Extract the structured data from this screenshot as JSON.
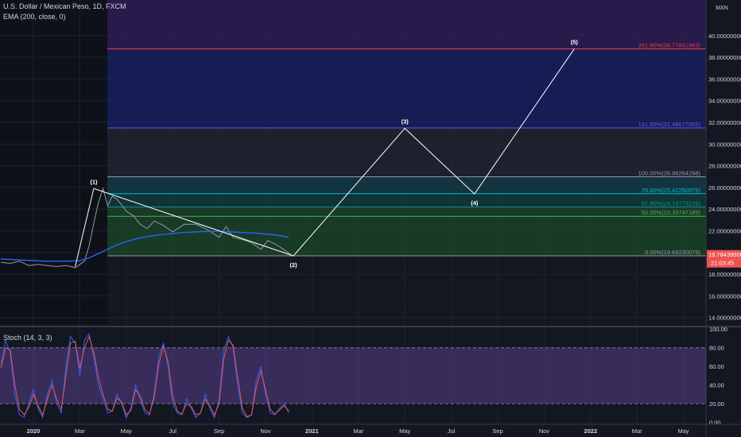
{
  "header": {
    "symbol_title": "U.S. Dollar / Mexican Peso, 1D, FXCM",
    "ema_label": "EMA (200, close, 0)",
    "stoch_label": "Stoch (14, 3, 3)",
    "currency": "MXN"
  },
  "colors": {
    "background": "#131722",
    "axis_text": "#d1d4dc",
    "price_line": "#9598a1",
    "ema": "#2962ff",
    "wave": "#ffffff",
    "stoch_k": "#2962ff",
    "stoch_d": "#ef5350",
    "price_tag": "#ef5350"
  },
  "chart_data": [
    {
      "type": "line",
      "title": "U.S. Dollar / Mexican Peso, 1D, FXCM",
      "xlabel": "",
      "ylabel": "",
      "ylim": [
        13,
        41
      ],
      "yticks": [
        14,
        16,
        18,
        20,
        22,
        24,
        26,
        28,
        30,
        32,
        34,
        36,
        38,
        40
      ],
      "ytick_labels": [
        "14.00000000",
        "16.00000000",
        "18.00000000",
        "20.00000000",
        "22.00000000",
        "24.00000000",
        "26.00000000",
        "28.00000000",
        "30.00000000",
        "32.00000000",
        "34.00000000",
        "36.00000000",
        "38.00000000",
        "40.00000000"
      ],
      "x_axis_labels": [
        "2020",
        "Mar",
        "May",
        "Jul",
        "Sep",
        "Nov",
        "2021",
        "Mar",
        "May",
        "Jul",
        "Sep",
        "Nov",
        "2022",
        "Mar",
        "May"
      ],
      "x_axis_months": [
        0,
        2,
        4,
        6,
        8,
        10,
        12,
        14,
        16,
        18,
        20,
        22,
        24,
        26,
        28
      ],
      "current_price": {
        "value": 19.78439,
        "label": "19.78439000",
        "countdown": "21:03:45"
      },
      "price_series": {
        "name": "USDMXN",
        "x": [
          -1.4,
          -1,
          -0.6,
          -0.2,
          0.2,
          0.6,
          1,
          1.4,
          1.8,
          2.0,
          2.2,
          2.4,
          2.6,
          2.8,
          3.0,
          3.2,
          3.4,
          3.6,
          3.8,
          4.0,
          4.3,
          4.6,
          4.9,
          5.2,
          5.6,
          6,
          6.5,
          7,
          7.5,
          8,
          8.3,
          8.6,
          9,
          9.4,
          9.8,
          10.1,
          10.4,
          10.7,
          11.1
        ],
        "y": [
          19.1,
          19.0,
          19.2,
          18.8,
          18.9,
          18.8,
          18.7,
          18.8,
          18.6,
          18.9,
          19.2,
          20.6,
          22.7,
          24.6,
          25.9,
          24.3,
          25.2,
          24.9,
          24.4,
          23.8,
          23.4,
          22.6,
          22.2,
          22.9,
          22.5,
          21.9,
          22.6,
          22.6,
          22.1,
          21.4,
          22.4,
          21.4,
          21.2,
          20.9,
          20.3,
          21.1,
          20.8,
          20.4,
          19.78
        ]
      },
      "ema_series": {
        "name": "EMA (200, close, 0)",
        "x": [
          -1.4,
          -0.5,
          0.5,
          1.5,
          2.0,
          2.4,
          2.8,
          3.2,
          3.6,
          4.0,
          4.5,
          5.0,
          5.5,
          6.0,
          6.5,
          7.0,
          7.5,
          8.0,
          8.5,
          9.0,
          9.5,
          10.0,
          10.5,
          11.0
        ],
        "y": [
          19.4,
          19.3,
          19.2,
          19.2,
          19.25,
          19.5,
          19.9,
          20.3,
          20.7,
          21.0,
          21.3,
          21.5,
          21.65,
          21.75,
          21.85,
          21.9,
          21.95,
          21.95,
          21.9,
          21.85,
          21.8,
          21.7,
          21.6,
          21.4
        ]
      },
      "elliott_waves": [
        {
          "label": "(1)",
          "x": 2.6,
          "y": 25.9
        },
        {
          "label": "(2)",
          "x": 11.2,
          "y": 19.69
        },
        {
          "label": "(3)",
          "x": 16.0,
          "y": 31.45
        },
        {
          "label": "(4)",
          "x": 19.0,
          "y": 25.4
        },
        {
          "label": "(5)",
          "x": 23.3,
          "y": 38.78
        }
      ],
      "wave_start": {
        "x": 1.8,
        "y": 18.7
      },
      "fib_levels": [
        {
          "ratio": "0.00%",
          "value": 19.69230079,
          "label": "0.00%(19.69230079)",
          "color": "#9598a1"
        },
        {
          "ratio": "50.00%",
          "value": 23.33747189,
          "label": "50.00%(23.33747189)",
          "color": "#4caf50"
        },
        {
          "ratio": "61.80%",
          "value": 24.19773226,
          "label": "61.80%(24.19773226)",
          "color": "#089981"
        },
        {
          "ratio": "78.60%",
          "value": 25.42250975,
          "label": "78.60%(25.42250975)",
          "color": "#00bcd4"
        },
        {
          "ratio": "100.00%",
          "value": 26.98264298,
          "label": "100.00%(26.98264298)",
          "color": "#9598a1"
        },
        {
          "ratio": "161.80%",
          "value": 31.48677805,
          "label": "161.80%(31.48677805)",
          "color": "#5b5ce2"
        },
        {
          "ratio": "261.80%",
          "value": 38.77841863,
          "label": "261.80%(38.77841863)",
          "color": "#f23645"
        }
      ]
    },
    {
      "type": "line",
      "title": "Stoch (14, 3, 3)",
      "ylim": [
        -3,
        100
      ],
      "yticks": [
        0,
        20,
        40,
        60,
        80,
        100
      ],
      "ytick_labels": [
        "0.00",
        "20.00",
        "40.00",
        "60.00",
        "80.00",
        "100.00"
      ],
      "bands": [
        20,
        80
      ],
      "series": [
        {
          "name": "%K",
          "x": [
            -1.4,
            -1.2,
            -1,
            -0.8,
            -0.6,
            -0.4,
            -0.2,
            0,
            0.2,
            0.4,
            0.6,
            0.8,
            1,
            1.2,
            1.4,
            1.6,
            1.8,
            2.0,
            2.2,
            2.4,
            2.6,
            2.8,
            3.0,
            3.2,
            3.4,
            3.6,
            3.8,
            4.0,
            4.2,
            4.4,
            4.6,
            4.8,
            5.0,
            5.2,
            5.4,
            5.6,
            5.8,
            6.0,
            6.2,
            6.4,
            6.6,
            6.8,
            7.0,
            7.2,
            7.4,
            7.6,
            7.8,
            8.0,
            8.2,
            8.4,
            8.6,
            8.8,
            9.0,
            9.2,
            9.4,
            9.6,
            9.8,
            10.0,
            10.2,
            10.4,
            10.6,
            10.8,
            11.0
          ],
          "y": [
            62,
            88,
            75,
            30,
            8,
            5,
            20,
            35,
            15,
            5,
            30,
            45,
            20,
            10,
            60,
            92,
            85,
            50,
            88,
            95,
            70,
            40,
            25,
            10,
            12,
            30,
            20,
            5,
            15,
            40,
            25,
            10,
            8,
            30,
            70,
            85,
            60,
            20,
            10,
            8,
            25,
            15,
            5,
            10,
            30,
            15,
            5,
            25,
            78,
            92,
            80,
            40,
            10,
            5,
            8,
            45,
            60,
            30,
            10,
            8,
            15,
            20,
            10
          ]
        },
        {
          "name": "%D",
          "x": [
            -1.4,
            -1.2,
            -1,
            -0.8,
            -0.6,
            -0.4,
            -0.2,
            0,
            0.2,
            0.4,
            0.6,
            0.8,
            1,
            1.2,
            1.4,
            1.6,
            1.8,
            2.0,
            2.2,
            2.4,
            2.6,
            2.8,
            3.0,
            3.2,
            3.4,
            3.6,
            3.8,
            4.0,
            4.2,
            4.4,
            4.6,
            4.8,
            5.0,
            5.2,
            5.4,
            5.6,
            5.8,
            6.0,
            6.2,
            6.4,
            6.6,
            6.8,
            7.0,
            7.2,
            7.4,
            7.6,
            7.8,
            8.0,
            8.2,
            8.4,
            8.6,
            8.8,
            9.0,
            9.2,
            9.4,
            9.6,
            9.8,
            10.0,
            10.2,
            10.4,
            10.6,
            10.8,
            11.0
          ],
          "y": [
            58,
            80,
            78,
            40,
            14,
            8,
            16,
            30,
            18,
            8,
            25,
            40,
            25,
            14,
            50,
            85,
            87,
            58,
            80,
            92,
            75,
            48,
            30,
            14,
            12,
            26,
            22,
            8,
            13,
            35,
            28,
            14,
            9,
            26,
            62,
            82,
            65,
            28,
            12,
            9,
            20,
            17,
            8,
            10,
            25,
            18,
            8,
            20,
            68,
            88,
            83,
            48,
            15,
            6,
            8,
            38,
            55,
            35,
            14,
            9,
            13,
            18,
            12
          ]
        }
      ]
    }
  ]
}
